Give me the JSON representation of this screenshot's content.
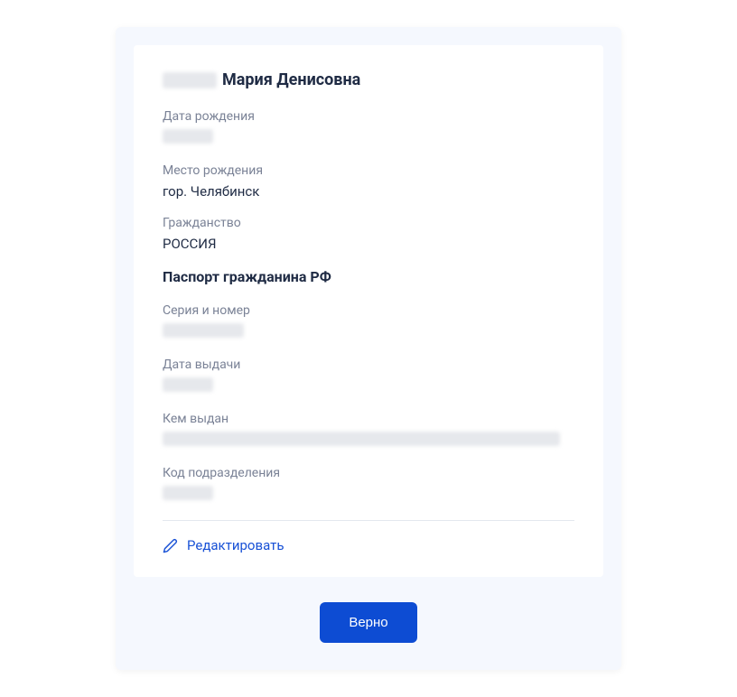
{
  "person": {
    "surname_redacted": true,
    "name_patronymic": "Мария Денисовна"
  },
  "fields": {
    "birth_date": {
      "label": "Дата рождения",
      "value_redacted": true
    },
    "birth_place": {
      "label": "Место рождения",
      "value": "гор. Челябинск"
    },
    "citizenship": {
      "label": "Гражданство",
      "value": "РОССИЯ"
    }
  },
  "passport": {
    "title": "Паспорт гражданина РФ",
    "series_number": {
      "label": "Серия и номер",
      "value_redacted": true
    },
    "issue_date": {
      "label": "Дата выдачи",
      "value_redacted": true
    },
    "issued_by": {
      "label": "Кем выдан",
      "value_redacted": true
    },
    "dept_code": {
      "label": "Код подразделения",
      "value_redacted": true
    }
  },
  "actions": {
    "edit": "Редактировать",
    "confirm": "Верно"
  }
}
